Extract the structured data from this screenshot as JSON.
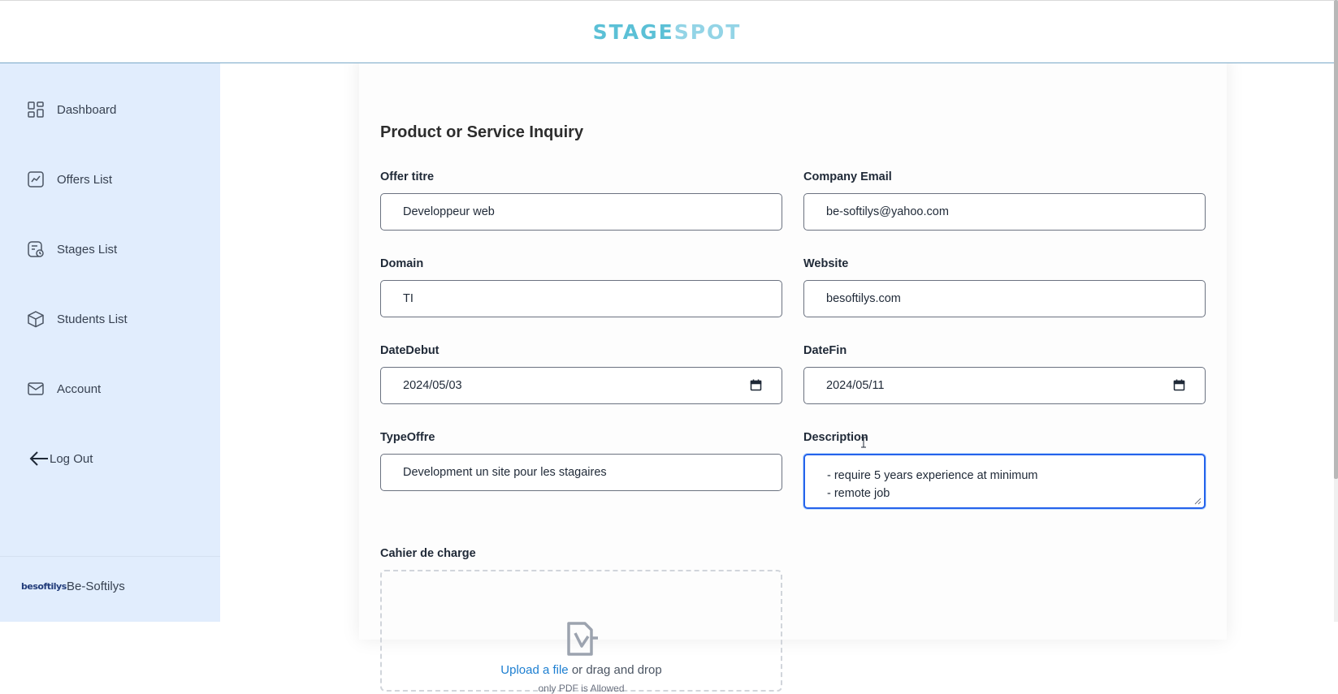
{
  "header": {
    "logo_part1": "STAGE",
    "logo_part2": "SPOT"
  },
  "sidebar": {
    "items": [
      {
        "label": "Dashboard",
        "icon": "dashboard-icon"
      },
      {
        "label": "Offers List",
        "icon": "chart-line-icon"
      },
      {
        "label": "Stages List",
        "icon": "file-clock-icon"
      },
      {
        "label": "Students List",
        "icon": "box-icon"
      },
      {
        "label": "Account",
        "icon": "mail-icon"
      }
    ],
    "logout_label": "Log Out",
    "company": {
      "logo_text": "besoftilys",
      "name": "Be-Softilys"
    }
  },
  "form": {
    "title": "Product or Service Inquiry",
    "fields": {
      "offer_titre": {
        "label": "Offer titre",
        "value": "Developpeur web"
      },
      "company_email": {
        "label": "Company Email",
        "value": "be-softilys@yahoo.com"
      },
      "domain": {
        "label": "Domain",
        "value": "TI"
      },
      "website": {
        "label": "Website",
        "value": "besoftilys.com"
      },
      "date_debut": {
        "label": "DateDebut",
        "value": "2024/05/03"
      },
      "date_fin": {
        "label": "DateFin",
        "value": "2024/05/11"
      },
      "type_offre": {
        "label": "TypeOffre",
        "value": "Development un site pour les stagaires"
      },
      "description": {
        "label": "Description",
        "line1": "- require 5 years experience at minimum",
        "line2": "- remote job"
      }
    },
    "upload": {
      "label": "Cahier de charge",
      "link_text": "Upload a file",
      "rest_text": " or drag and drop",
      "hint": "only PDF is Allowed"
    }
  },
  "colors": {
    "accent": "#2563eb",
    "sidebar_bg": "#e1edfd",
    "logo": "#5bc0d6",
    "link": "#1d7fd1"
  }
}
